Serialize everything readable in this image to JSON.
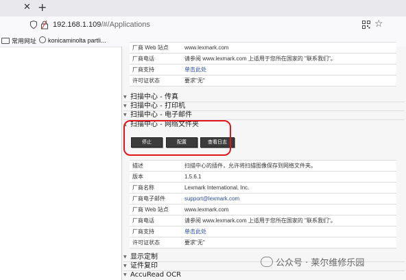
{
  "browser": {
    "url_host": "192.168.1.109",
    "url_path": "/#/Applications",
    "tab_close_glyph": "✕",
    "new_tab_glyph": "+",
    "bookmarks": [
      "常用网址",
      "konicaminolta partli..."
    ]
  },
  "section_upper": {
    "rows": [
      {
        "key": "厂商 Web 站点",
        "value": "www.lexmark.com"
      },
      {
        "key": "厂商电话",
        "value": "请参阅 www.lexmark.com 上适用于您所在国家的 \"联系我们\"。"
      },
      {
        "key": "厂商支持",
        "value": "单击此处"
      },
      {
        "key": "许可证状态",
        "value": "要求\"无\""
      }
    ]
  },
  "sections": [
    {
      "title": "扫描中心 - 传真"
    },
    {
      "title": "扫描中心 - 打印机"
    },
    {
      "title": "扫描中心 - 电子邮件"
    },
    {
      "title": "扫描中心 - 网络文件夹"
    }
  ],
  "buttons": {
    "stop": "停止",
    "configure": "配置",
    "view_log": "查看日志"
  },
  "details": {
    "rows": [
      {
        "key": "描述",
        "value": "扫描中心的插件，允许将扫描图像保存到网络文件夹。"
      },
      {
        "key": "版本",
        "value": "1.5.6.1"
      },
      {
        "key": "厂商名称",
        "value": "Lexmark International, Inc."
      },
      {
        "key": "厂商电子邮件",
        "value": "support@lexmark.com"
      },
      {
        "key": "厂商 Web 站点",
        "value": "www.lexmark.com"
      },
      {
        "key": "厂商电话",
        "value": "请参阅 www.lexmark.com 上适用于您所在国家的 \"联系我们\"。"
      },
      {
        "key": "厂商支持",
        "value": "单击此处"
      },
      {
        "key": "许可证状态",
        "value": "要求\"无\""
      }
    ]
  },
  "sections_bottom": [
    {
      "title": "显示定制"
    },
    {
      "title": "证件复印"
    },
    {
      "title": "AccuRead OCR"
    }
  ],
  "watermark": "公众号 · 莱尔维修乐园",
  "colors": {
    "highlight": "#e0141b",
    "button": "#3c3c3c"
  }
}
